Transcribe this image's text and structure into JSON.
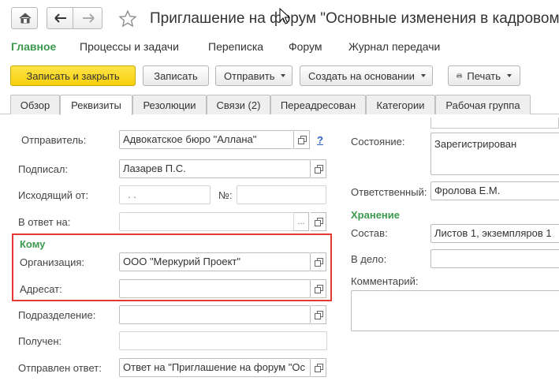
{
  "window": {
    "title": "Приглашение на форум \"Основные изменения в кадровом"
  },
  "menu": {
    "items": [
      {
        "label": "Главное",
        "active": true
      },
      {
        "label": "Процессы и задачи"
      },
      {
        "label": "Переписка"
      },
      {
        "label": "Форум"
      },
      {
        "label": "Журнал передачи"
      }
    ]
  },
  "toolbar": {
    "save_close": "Записать и закрыть",
    "save": "Записать",
    "send": "Отправить",
    "create_based": "Создать на основании",
    "print": "Печать"
  },
  "tabs": [
    "Обзор",
    "Реквизиты",
    "Резолюции",
    "Связи (2)",
    "Переадресован",
    "Категории",
    "Рабочая группа"
  ],
  "left": {
    "sender_label": "Отправитель:",
    "sender_value": "Адвокатское бюро \"Аллана\"",
    "help": "?",
    "signed_label": "Подписал:",
    "signed_value": "Лазарев П.С.",
    "outgoing_label": "Исходящий от:",
    "outgoing_date": ".  .",
    "number_label": "№:",
    "reply_label": "В ответ на:",
    "reply_dots": "...",
    "to_section": "Кому",
    "org_label": "Организация:",
    "org_value": "ООО \"Меркурий Проект\"",
    "addressee_label": "Адресат:",
    "department_label": "Подразделение:",
    "received_label": "Получен:",
    "answer_label": "Отправлен ответ:",
    "answer_value": "Ответ на \"Приглашение на форум \"Ос"
  },
  "right": {
    "status_label": "Состояние:",
    "status_value": "Зарегистрирован",
    "responsible_label": "Ответственный:",
    "responsible_value": "Фролова Е.М.",
    "storage_section": "Хранение",
    "composition_label": "Состав:",
    "composition_value": "Листов 1, экземпляров 1",
    "file_label": "В дело:",
    "comment_label": "Комментарий:"
  }
}
